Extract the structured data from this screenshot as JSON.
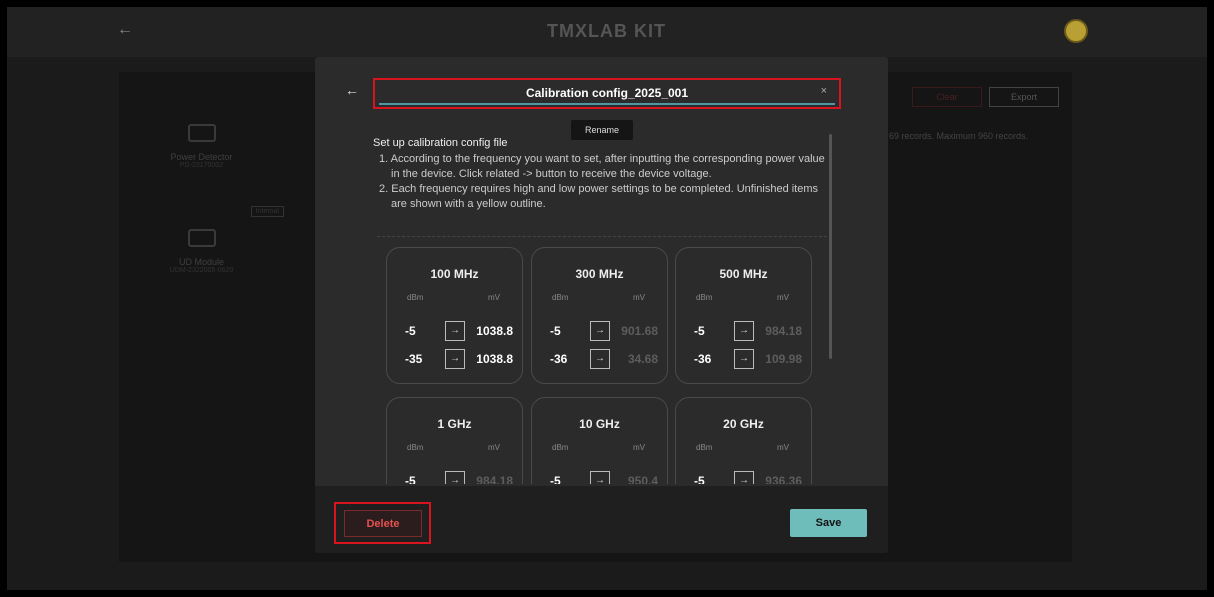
{
  "app": {
    "logo": "TMXLAB KIT",
    "back_icon": "arrow-left-icon",
    "avatar_icon": "user-icon"
  },
  "background": {
    "devices": [
      {
        "name": "Power Detector",
        "serial": "PD-23170002"
      },
      {
        "name": "UD Module",
        "serial": "UDM-2322005-0620",
        "badge": "Internal"
      }
    ],
    "clear_label": "Clear",
    "export_label": "Export",
    "records_text": "69 records. Maximum 960 records."
  },
  "modal": {
    "title_value": "Calibration config_2025_001",
    "tooltip": "Rename",
    "section_title": "Set up calibration config file",
    "instructions": [
      "1. According to the frequency you want to set, after inputting the corresponding power value in the device. Click related -> button to receive the device voltage.",
      "2. Each frequency requires high and low power settings to be completed. Unfinished items are shown with a yellow outline."
    ],
    "col_dbm": "dBm",
    "col_mv": "mV",
    "arrow": "→",
    "cards": [
      {
        "freq": "100 MHz",
        "rows": [
          {
            "dbm": "-5",
            "mv": "1038.8",
            "status": "full"
          },
          {
            "dbm": "-35",
            "mv": "1038.8",
            "status": "full"
          }
        ]
      },
      {
        "freq": "300 MHz",
        "rows": [
          {
            "dbm": "-5",
            "mv": "901.68",
            "status": "pending"
          },
          {
            "dbm": "-36",
            "mv": "34.68",
            "status": "pending"
          }
        ]
      },
      {
        "freq": "500 MHz",
        "rows": [
          {
            "dbm": "-5",
            "mv": "984.18",
            "status": "pending"
          },
          {
            "dbm": "-36",
            "mv": "109.98",
            "status": "pending"
          }
        ]
      },
      {
        "freq": "1 GHz",
        "rows": [
          {
            "dbm": "-5",
            "mv": "984.18",
            "status": "pending"
          }
        ]
      },
      {
        "freq": "10 GHz",
        "rows": [
          {
            "dbm": "-5",
            "mv": "950.4",
            "status": "pending"
          }
        ]
      },
      {
        "freq": "20 GHz",
        "rows": [
          {
            "dbm": "-5",
            "mv": "936.36",
            "status": "pending"
          }
        ]
      }
    ],
    "delete_label": "Delete",
    "save_label": "Save"
  }
}
